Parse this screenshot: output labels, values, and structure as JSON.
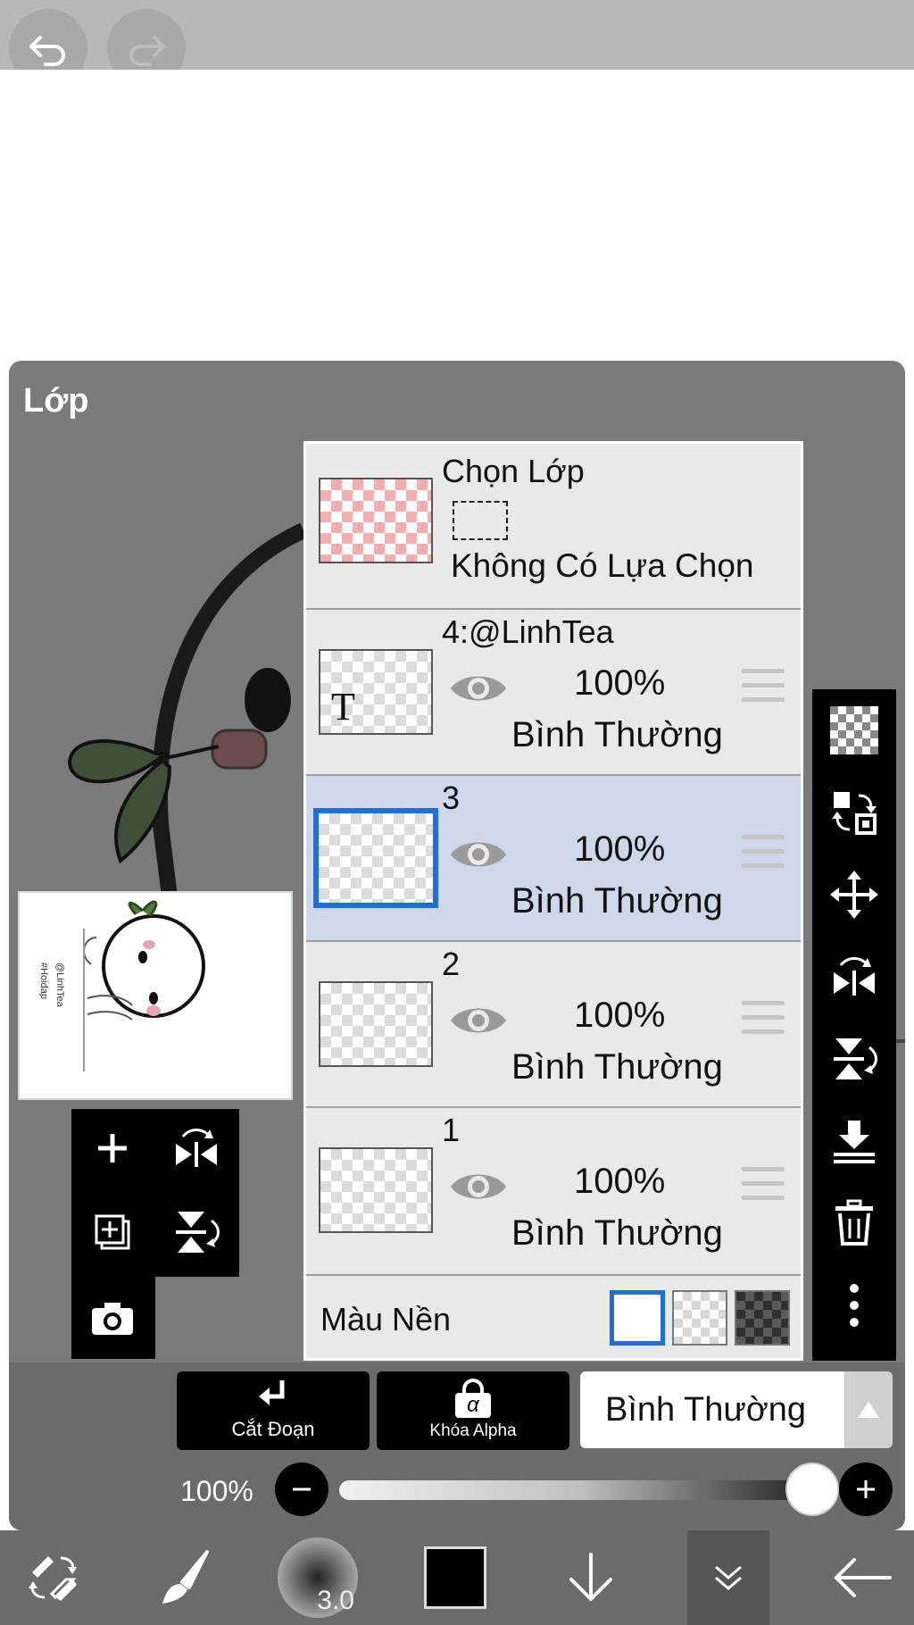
{
  "panel": {
    "title": "Lớp"
  },
  "selection": {
    "title": "Chọn Lớp",
    "status": "Không Có Lựa Chọn"
  },
  "layers": [
    {
      "name": "4:@LinhTea",
      "opacity": "100%",
      "blend": "Bình Thường",
      "selected": false,
      "thumb_letter": "T"
    },
    {
      "name": "3",
      "opacity": "100%",
      "blend": "Bình Thường",
      "selected": true
    },
    {
      "name": "2",
      "opacity": "100%",
      "blend": "Bình Thường",
      "selected": false
    },
    {
      "name": "1",
      "opacity": "100%",
      "blend": "Bình Thường",
      "selected": false
    }
  ],
  "background": {
    "label": "Màu Nền",
    "options": [
      "white",
      "transparent",
      "dark"
    ],
    "selected": "white"
  },
  "preview": {
    "watermark_1": "@LinhTea",
    "watermark_2": "#Hoidap"
  },
  "actions": {
    "clip_label": "Cắt Đoạn",
    "alpha_icon": "α",
    "alpha_label": "Khóa Alpha",
    "blend_mode": "Bình Thường"
  },
  "opacity": {
    "label": "100%",
    "value": 100
  },
  "toolbar": {
    "brush_size": "3.0",
    "current_color": "#000000"
  },
  "icons": {
    "top": [
      "undo-icon",
      "redo-icon"
    ],
    "left_tools": [
      "add-layer-icon",
      "flip-horizontal-icon",
      "copy-layer-icon",
      "flip-vertical-icon",
      "camera-icon"
    ],
    "right_tools": [
      "checkerboard-icon",
      "transform-swap-icon",
      "move-icon",
      "flip-horizontal-icon",
      "flip-vertical-icon",
      "merge-down-icon",
      "trash-icon",
      "more-icon"
    ],
    "bottom": [
      "swap-tools-icon",
      "brush-icon",
      "brush-size-icon",
      "color-icon",
      "download-icon",
      "collapse-icon",
      "back-icon"
    ]
  },
  "colors": {
    "accent": "#1e6fd9",
    "selected_row": "#cdd9ea",
    "panel_bg": "#7a7a7a",
    "toolbar_bg": "#6b6b6b"
  }
}
